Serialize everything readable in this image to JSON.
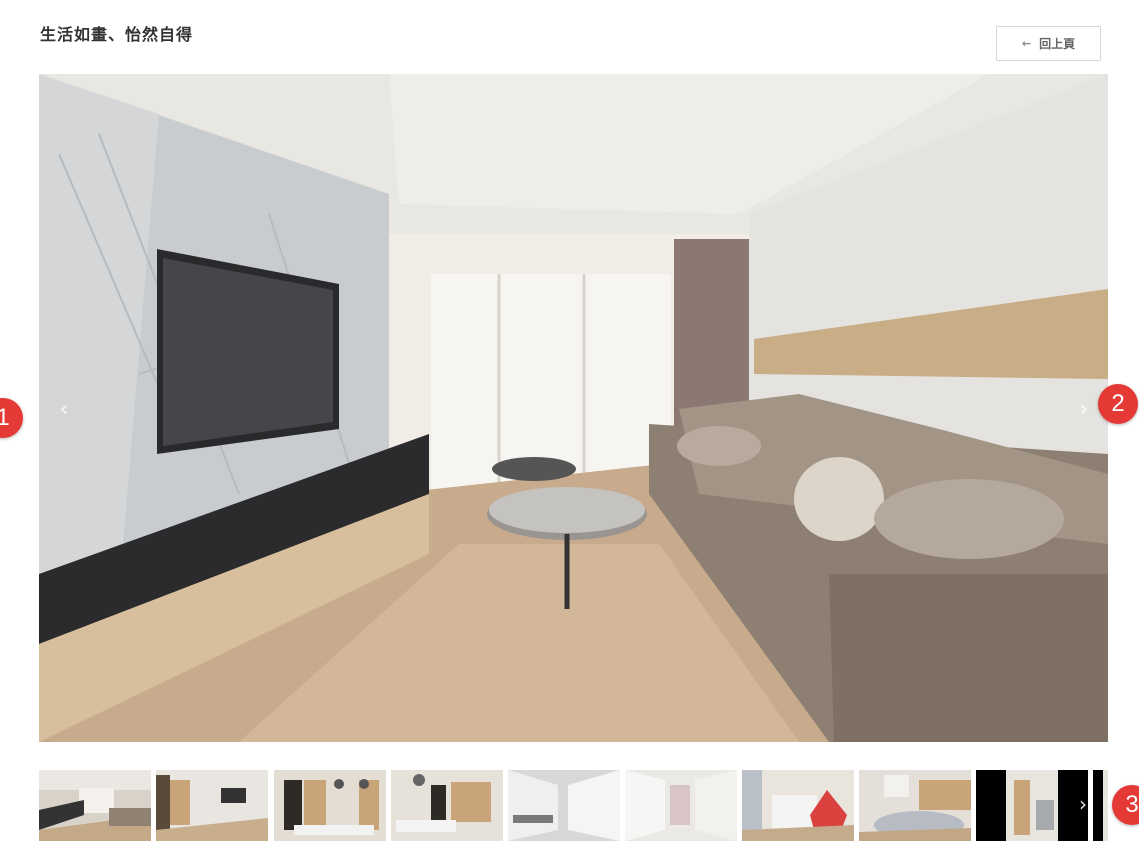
{
  "header": {
    "title": "生活如畫、怡然自得",
    "back_label": "回上頁",
    "back_icon": "arrow-left-icon"
  },
  "gallery": {
    "prev_icon": "chevron-left-icon",
    "next_icon": "chevron-right-icon",
    "thumb_next_icon": "chevron-right-icon",
    "thumbnail_count_visible": 10
  },
  "annotations": [
    "1",
    "2",
    "3"
  ],
  "colors": {
    "badge": "#e53935",
    "button_border": "#d6d6d6"
  }
}
